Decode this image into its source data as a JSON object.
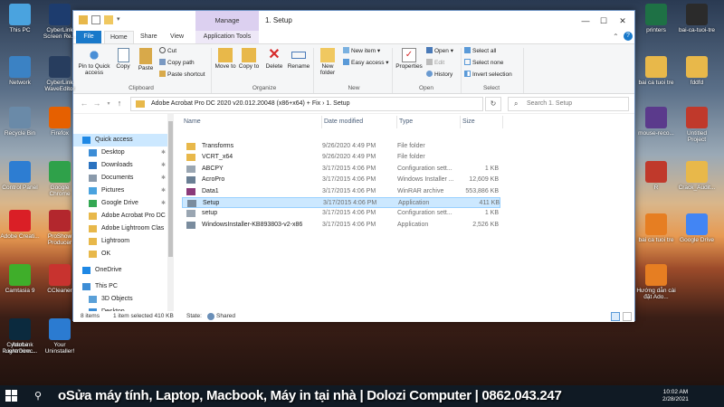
{
  "desktop": {
    "left_icons": [
      {
        "label": "This PC",
        "color": "#4aa3df"
      },
      {
        "label": "CyberLink Screen Re...",
        "color": "#1d3c6e"
      },
      {
        "label": "Network",
        "color": "#3b82c4"
      },
      {
        "label": "CyberLink WaveEditor",
        "color": "#273d5e"
      },
      {
        "label": "Recycle Bin",
        "color": "#6a8aa8"
      },
      {
        "label": "Firefox",
        "color": "#e66000"
      },
      {
        "label": "Control Panel",
        "color": "#2d7dd2"
      },
      {
        "label": "Google Chrome",
        "color": "#2fa14a"
      },
      {
        "label": "Adobe Creati...",
        "color": "#da1f26"
      },
      {
        "label": "ProShow Producer",
        "color": "#b3272d"
      },
      {
        "label": "Camtasia 9",
        "color": "#3fae2a"
      },
      {
        "label": "CCleaner",
        "color": "#c8332f"
      },
      {
        "label": "CyberLink PowerDirec...",
        "color": "#0f1f36"
      },
      {
        "label": "Your Uninstaller!",
        "color": "#2b7bd1"
      },
      {
        "label": "Adobe Lightroom...",
        "color": "#0b2a3e"
      }
    ],
    "right_icons": [
      {
        "label": "printers",
        "color": "#1e7145"
      },
      {
        "label": "bai-ca-tuoi-tre",
        "color": "#2b2b2b"
      },
      {
        "label": "bai ca tuoi tre",
        "color": "#e8b84a"
      },
      {
        "label": "fddfd",
        "color": "#e8b84a"
      },
      {
        "label": "mouse-reco...",
        "color": "#5b3a8c"
      },
      {
        "label": "Untitled Project",
        "color": "#c0392b"
      },
      {
        "label": "R",
        "color": "#c0392b"
      },
      {
        "label": "Crack_Audit...",
        "color": "#e8b84a"
      },
      {
        "label": "bai ca tuoi tre",
        "color": "#e67e22"
      },
      {
        "label": "Google Drive",
        "color": "#4285f4"
      },
      {
        "label": "Hướng dẫn cài đặt Ado...",
        "color": "#e67e22"
      }
    ]
  },
  "window": {
    "title": "1. Setup",
    "manage_label": "Manage",
    "tabs": [
      "File",
      "Home",
      "Share",
      "View",
      "Application Tools"
    ],
    "ribbon": {
      "clipboard": {
        "pin": "Pin to Quick access",
        "copy": "Copy",
        "paste": "Paste",
        "cut": "Cut",
        "copy_path": "Copy path",
        "paste_shortcut": "Paste shortcut",
        "label": "Clipboard"
      },
      "organize": {
        "move_to": "Move to",
        "copy_to": "Copy to",
        "delete": "Delete",
        "rename": "Rename",
        "label": "Organize"
      },
      "new": {
        "new_folder": "New folder",
        "new_item": "New item ▾",
        "easy_access": "Easy access ▾",
        "label": "New"
      },
      "open": {
        "properties": "Properties",
        "open": "Open ▾",
        "edit": "Edit",
        "history": "History",
        "label": "Open"
      },
      "select": {
        "select_all": "Select all",
        "select_none": "Select none",
        "invert": "Invert selection",
        "label": "Select"
      }
    },
    "address": "Adobe Acrobat Pro DC 2020 v20.012.20048 (x86+x64) + Fix  ›  1. Setup",
    "search_placeholder": "Search 1. Setup",
    "nav": [
      {
        "label": "Quick access",
        "icon": "star-icon",
        "color": "#1e88e5",
        "pin": "",
        "indent": 0,
        "selected": true
      },
      {
        "label": "Desktop",
        "icon": "desktop-icon",
        "color": "#3c8dd6",
        "pin": "✱",
        "indent": 1
      },
      {
        "label": "Downloads",
        "icon": "download-icon",
        "color": "#2a72c0",
        "pin": "✱",
        "indent": 1
      },
      {
        "label": "Documents",
        "icon": "documents-icon",
        "color": "#8a9aab",
        "pin": "✱",
        "indent": 1
      },
      {
        "label": "Pictures",
        "icon": "pictures-icon",
        "color": "#4aa3df",
        "pin": "✱",
        "indent": 1
      },
      {
        "label": "Google Drive",
        "icon": "google-drive-icon",
        "color": "#34a853",
        "pin": "✱",
        "indent": 1
      },
      {
        "label": "Adobe Acrobat Pro DC",
        "icon": "folder-icon",
        "color": "#e8b84a",
        "pin": "",
        "indent": 1
      },
      {
        "label": "Adobe Lightroom Clas",
        "icon": "folder-icon",
        "color": "#e8b84a",
        "pin": "",
        "indent": 1
      },
      {
        "label": "Lightroom",
        "icon": "folder-icon",
        "color": "#e8b84a",
        "pin": "",
        "indent": 1
      },
      {
        "label": "OK",
        "icon": "folder-icon",
        "color": "#e8b84a",
        "pin": "",
        "indent": 1
      },
      {
        "label": "OneDrive",
        "icon": "cloud-icon",
        "color": "#1e88e5",
        "pin": "",
        "indent": 0
      },
      {
        "label": "This PC",
        "icon": "pc-icon",
        "color": "#3c8dd6",
        "pin": "",
        "indent": 0
      },
      {
        "label": "3D Objects",
        "icon": "cube-icon",
        "color": "#5aa0d8",
        "pin": "",
        "indent": 1
      },
      {
        "label": "Desktop",
        "icon": "desktop-icon",
        "color": "#3c8dd6",
        "pin": "",
        "indent": 1
      }
    ],
    "columns": [
      "Name",
      "Date modified",
      "Type",
      "Size"
    ],
    "files": [
      {
        "name": "Transforms",
        "date": "9/26/2020 4:49 PM",
        "type": "File folder",
        "size": "",
        "icon": "folder-icon",
        "color": "#e8b84a"
      },
      {
        "name": "VCRT_x64",
        "date": "9/26/2020 4:49 PM",
        "type": "File folder",
        "size": "",
        "icon": "folder-icon",
        "color": "#e8b84a"
      },
      {
        "name": "ABCPY",
        "date": "3/17/2015 4:06 PM",
        "type": "Configuration sett...",
        "size": "1 KB",
        "icon": "config-file-icon",
        "color": "#9aa6b2"
      },
      {
        "name": "AcroPro",
        "date": "3/17/2015 4:06 PM",
        "type": "Windows Installer ...",
        "size": "12,609 KB",
        "icon": "installer-icon",
        "color": "#6a7f94"
      },
      {
        "name": "Data1",
        "date": "3/17/2015 4:06 PM",
        "type": "WinRAR archive",
        "size": "553,886 KB",
        "icon": "winrar-icon",
        "color": "#8b3a7a"
      },
      {
        "name": "Setup",
        "date": "3/17/2015 4:06 PM",
        "type": "Application",
        "size": "411 KB",
        "icon": "application-icon",
        "color": "#7a8c9e",
        "selected": true
      },
      {
        "name": "setup",
        "date": "3/17/2015 4:06 PM",
        "type": "Configuration sett...",
        "size": "1 KB",
        "icon": "config-file-icon",
        "color": "#9aa6b2"
      },
      {
        "name": "WindowsInstaller-KB893803-v2-x86",
        "date": "3/17/2015 4:06 PM",
        "type": "Application",
        "size": "2,526 KB",
        "icon": "application-icon",
        "color": "#7a8c9e"
      }
    ],
    "status": {
      "items": "8 items",
      "selected": "1 item selected  410 KB",
      "state": "State:",
      "shared": "Shared"
    }
  },
  "overlay_text": "oSửa máy tính, Laptop, Macbook, Máy in tại nhà | Dolozi Computer | 0862.043.247",
  "taskbar": {
    "time": "10:02 AM",
    "date": "2/28/2021"
  }
}
